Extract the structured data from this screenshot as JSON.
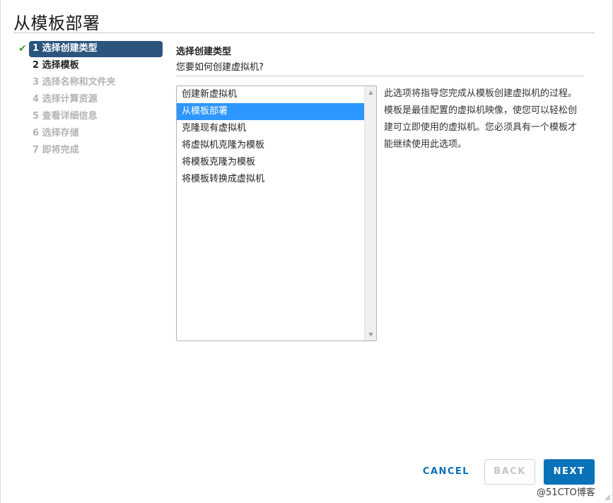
{
  "dialog": {
    "title": "从模板部署"
  },
  "steps": [
    {
      "label": "1 选择创建类型",
      "state": "active",
      "completed": true
    },
    {
      "label": "2 选择模板",
      "state": "next"
    },
    {
      "label": "3 选择名称和文件夹",
      "state": "disabled"
    },
    {
      "label": "4 选择计算资源",
      "state": "disabled"
    },
    {
      "label": "5 查看详细信息",
      "state": "disabled"
    },
    {
      "label": "6 选择存储",
      "state": "disabled"
    },
    {
      "label": "7 即将完成",
      "state": "disabled"
    }
  ],
  "main": {
    "heading": "选择创建类型",
    "subheading": "您要如何创建虚拟机?",
    "list": [
      {
        "label": "创建新虚拟机",
        "selected": false
      },
      {
        "label": "从模板部署",
        "selected": true
      },
      {
        "label": "克隆现有虚拟机",
        "selected": false
      },
      {
        "label": "将虚拟机克隆为模板",
        "selected": false
      },
      {
        "label": "将模板克隆为模板",
        "selected": false
      },
      {
        "label": "将模板转换成虚拟机",
        "selected": false
      }
    ],
    "description": "此选项将指导您完成从模板创建虚拟机的过程。模板是最佳配置的虚拟机映像，使您可以轻松创建可立即使用的虚拟机。您必须具有一个模板才能继续使用此选项。"
  },
  "footer": {
    "cancel_label": "CANCEL",
    "back_label": "BACK",
    "next_label": "NEXT"
  },
  "watermark": "@51CTO博客",
  "colors": {
    "active_step_bg": "#2b557d",
    "selected_item_bg": "#2e96ff",
    "primary_button": "#0a72b8",
    "check_green": "#3d9a3a"
  }
}
